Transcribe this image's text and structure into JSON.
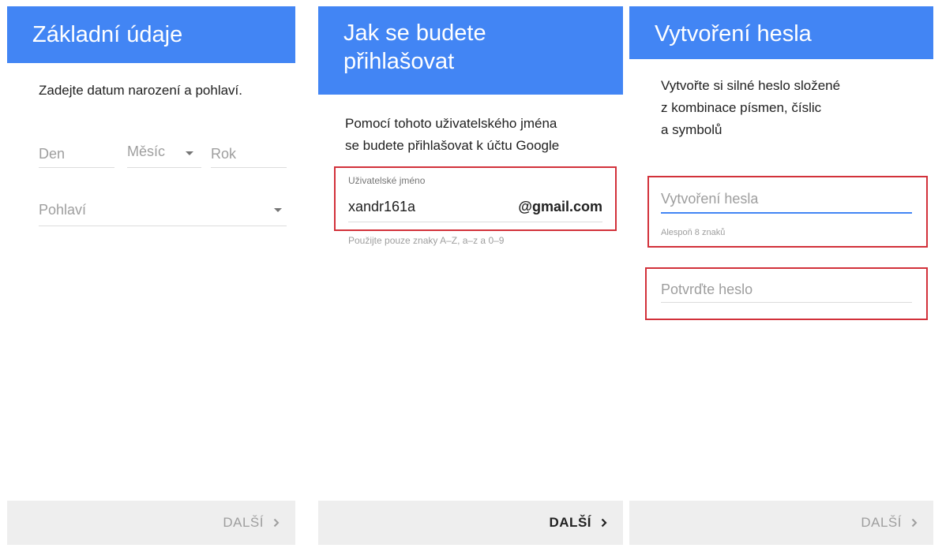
{
  "panel1": {
    "title": "Základní údaje",
    "instruction": "Zadejte datum narození a pohlaví.",
    "day_placeholder": "Den",
    "month_placeholder": "Měsíc",
    "year_placeholder": "Rok",
    "gender_placeholder": "Pohlaví",
    "next_label": "DALŠÍ"
  },
  "panel2": {
    "title": "Jak se budete\npřihlašovat",
    "instruction_line1": "Pomocí tohoto uživatelského jména",
    "instruction_line2": "se budete přihlašovat k účtu Google",
    "username_label": "Uživatelské jméno",
    "username_value": "xandr161a",
    "domain_suffix": "@gmail.com",
    "helper_text": "Použijte pouze znaky A–Z, a–z a 0–9",
    "next_label": "DALŠÍ"
  },
  "panel3": {
    "title": "Vytvoření hesla",
    "instruction_line1": "Vytvořte si silné heslo složené",
    "instruction_line2": "z kombinace písmen, číslic",
    "instruction_line3": "a symbolů",
    "password_placeholder": "Vytvoření hesla",
    "password_helper": "Alespoň 8 znaků",
    "confirm_placeholder": "Potvrďte heslo",
    "next_label": "DALŠÍ"
  },
  "colors": {
    "header_blue": "#4285f4",
    "highlight_red": "#d2313a",
    "footer_gray": "#eeeeee"
  },
  "icons": {
    "dropdown": "caret-down-icon",
    "next": "chevron-right-icon"
  }
}
